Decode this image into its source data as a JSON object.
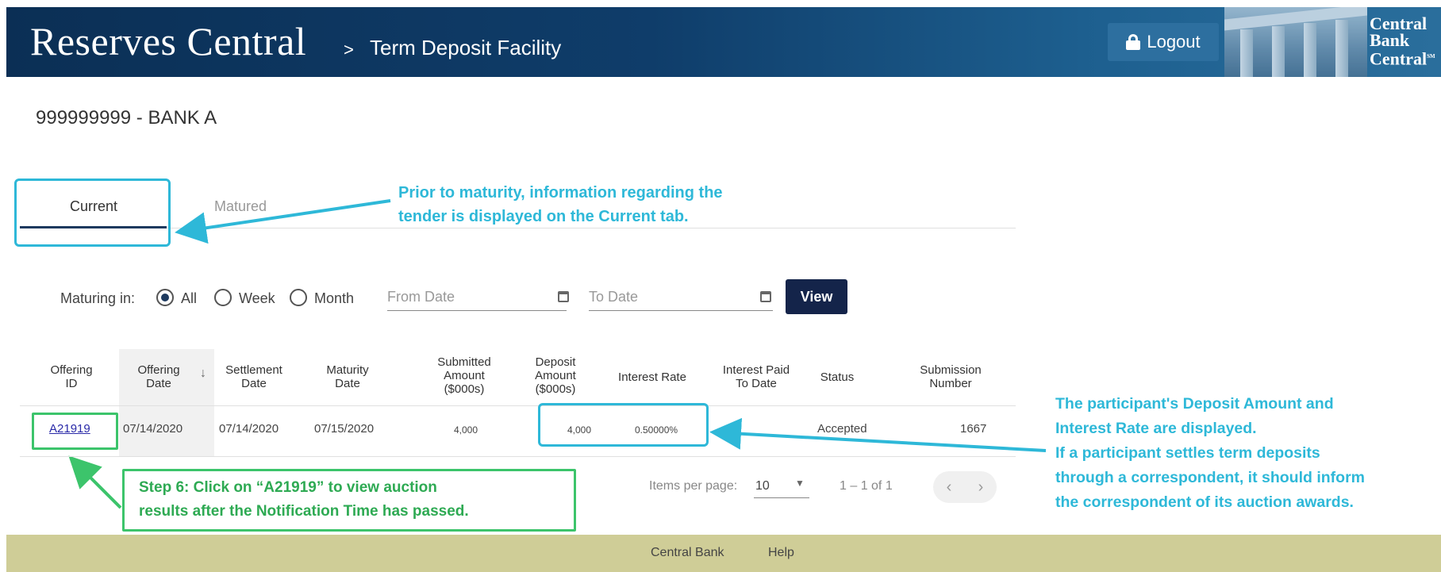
{
  "header": {
    "app_title": "Reserves Central",
    "separator": ">",
    "breadcrumb": "Term Deposit Facility",
    "logout_label": "Logout",
    "logo_lines": [
      "Central",
      "Bank",
      "Central"
    ],
    "logo_mark": "SM"
  },
  "bank_label": "999999999 - BANK A",
  "tabs": [
    {
      "label": "Current",
      "active": true
    },
    {
      "label": "Matured",
      "active": false
    }
  ],
  "filter": {
    "label": "Maturing in:",
    "options": [
      {
        "label": "All",
        "selected": true
      },
      {
        "label": "Week",
        "selected": false
      },
      {
        "label": "Month",
        "selected": false
      }
    ],
    "from_date_placeholder": "From Date",
    "to_date_placeholder": "To Date",
    "view_label": "View"
  },
  "table": {
    "headers": [
      [
        "Offering",
        "ID"
      ],
      [
        "Offering",
        "Date"
      ],
      [
        "Settlement",
        "Date"
      ],
      [
        "Maturity",
        "Date"
      ],
      [
        "Submitted",
        "Amount",
        "($000s)"
      ],
      [
        "Deposit",
        "Amount",
        "($000s)"
      ],
      [
        "Interest Rate"
      ],
      [
        "Interest Paid",
        "To Date"
      ],
      [
        "Status"
      ],
      [
        "Submission",
        "Number"
      ]
    ],
    "rows": [
      {
        "offering_id": "A21919",
        "offering_date": "07/14/2020",
        "settlement_date": "07/14/2020",
        "maturity_date": "07/15/2020",
        "submitted_amount": "4,000",
        "deposit_amount": "4,000",
        "interest_rate": "0.50000%",
        "interest_paid": "",
        "status": "Accepted",
        "submission_number": "1667"
      }
    ]
  },
  "pagination": {
    "items_per_page_label": "Items per page:",
    "items_per_page_value": "10",
    "range": "1 – 1 of 1",
    "prev": "‹",
    "next": "›"
  },
  "annotations": {
    "tab_note": [
      "Prior to maturity, information regarding the",
      "tender  is displayed on the Current tab."
    ],
    "deposit_note": [
      "The participant's Deposit Amount and",
      "Interest Rate are displayed.",
      "If a participant settles term deposits",
      "through a correspondent, it  should inform",
      "the correspondent of its auction awards."
    ],
    "step_note": [
      "Step 6:  Click on “A21919” to view auction",
      "results after the Notification Time has passed."
    ]
  },
  "footer": {
    "links": [
      "Central Bank",
      "Help"
    ]
  },
  "colors": {
    "header_navy": "#0b2f55",
    "callout_cyan": "#2eb8d8",
    "callout_green": "#3cc46b",
    "button_navy": "#14244a",
    "footer_khaki": "#cfcd97"
  }
}
